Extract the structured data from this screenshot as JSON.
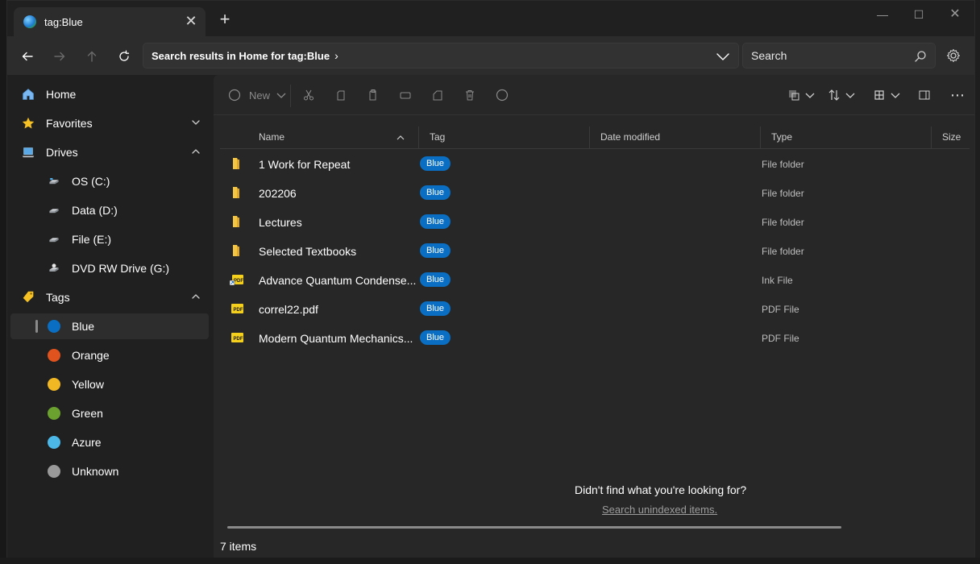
{
  "tab": {
    "title": "tag:Blue",
    "close": "✕",
    "new": "+"
  },
  "window_controls": {
    "minimize": "—",
    "maximize": "☐",
    "close": "✕"
  },
  "address": {
    "breadcrumb": "Search results in Home for tag:Blue"
  },
  "search": {
    "placeholder": "Search"
  },
  "toolbar": {
    "new_label": "New"
  },
  "sidebar": {
    "items": [
      {
        "label": "Home",
        "icon": "home-icon"
      },
      {
        "label": "Favorites",
        "icon": "star-icon"
      },
      {
        "label": "Drives",
        "icon": "laptop-icon"
      },
      {
        "label": "OS (C:)",
        "icon": "drive-icon"
      },
      {
        "label": "Data (D:)",
        "icon": "drive-icon"
      },
      {
        "label": "File (E:)",
        "icon": "drive-icon"
      },
      {
        "label": "DVD RW Drive (G:)",
        "icon": "dvd-drive-icon"
      },
      {
        "label": "Tags",
        "icon": "tag-icon"
      },
      {
        "label": "Blue",
        "color": "#0a6fc2"
      },
      {
        "label": "Orange",
        "color": "#e0521e"
      },
      {
        "label": "Yellow",
        "color": "#f2b824"
      },
      {
        "label": "Green",
        "color": "#6ba22f"
      },
      {
        "label": "Azure",
        "color": "#4cb8e8"
      },
      {
        "label": "Unknown",
        "color": "#9a9a9a"
      }
    ]
  },
  "columns": {
    "name": "Name",
    "tag": "Tag",
    "date": "Date modified",
    "type": "Type",
    "size": "Size"
  },
  "files": [
    {
      "name": "1 Work for Repeat",
      "tag": "Blue",
      "type": "File folder",
      "icon": "folder-icon"
    },
    {
      "name": "202206",
      "tag": "Blue",
      "type": "File folder",
      "icon": "folder-icon"
    },
    {
      "name": "Lectures",
      "tag": "Blue",
      "type": "File folder",
      "icon": "folder-icon"
    },
    {
      "name": "Selected Textbooks",
      "tag": "Blue",
      "type": "File folder",
      "icon": "folder-icon"
    },
    {
      "name": "Advance Quantum Condense...",
      "tag": "Blue",
      "type": "Ink File",
      "icon": "pdf-shortcut-icon"
    },
    {
      "name": "correl22.pdf",
      "tag": "Blue",
      "type": "PDF File",
      "icon": "pdf-icon"
    },
    {
      "name": "Modern Quantum Mechanics...",
      "tag": "Blue",
      "type": "PDF File",
      "icon": "pdf-icon"
    }
  ],
  "empty_prompt": {
    "question": "Didn't find what you're looking for?",
    "link": "Search unindexed items."
  },
  "status": {
    "count": "7 items"
  },
  "colors": {
    "accent": "#0a6fc2",
    "tag_bg": "#0a6fc2",
    "folder": "#f4c542"
  }
}
